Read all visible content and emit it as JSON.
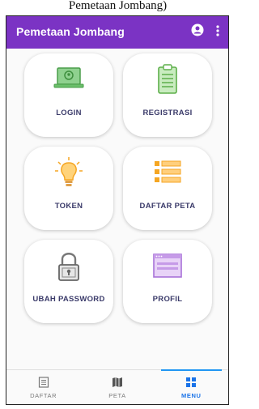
{
  "caption": "Pemetaan Jombang)",
  "appbar": {
    "title": "Pemetaan Jombang"
  },
  "menu": {
    "login": "LOGIN",
    "registrasi": "REGISTRASI",
    "token": "TOKEN",
    "daftar_peta": "DAFTAR PETA",
    "ubah_password": "UBAH PASSWORD",
    "profil": "PROFIL"
  },
  "bottom_nav": {
    "daftar": "DAFTAR",
    "peta": "PETA",
    "menu": "MENU",
    "active": "MENU"
  },
  "colors": {
    "appbar": "#7b33c4",
    "active_tab": "#1a73e8",
    "login_icon": "#5cb85c",
    "registrasi_icon": "#6bbf4e",
    "token_icon": "#f5a623",
    "daftar_peta_icon": "#f5a623",
    "ubah_password_icon": "#777777",
    "profil_icon": "#a872d8"
  },
  "icons": [
    "account-circle-icon",
    "more-vert-icon",
    "laptop-icon",
    "clipboard-icon",
    "lightbulb-icon",
    "list-icon",
    "padlock-icon",
    "browser-window-icon",
    "list-tab-icon",
    "map-tab-icon",
    "grid-tab-icon"
  ]
}
